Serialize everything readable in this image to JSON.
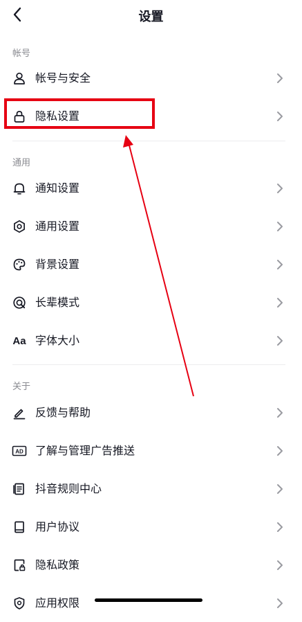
{
  "header": {
    "title": "设置"
  },
  "sections": {
    "account": {
      "label": "帐号"
    },
    "general": {
      "label": "通用"
    },
    "about": {
      "label": "关于"
    }
  },
  "items": {
    "account_security": "帐号与安全",
    "privacy_settings": "隐私设置",
    "notification_settings": "通知设置",
    "general_settings": "通用设置",
    "background_settings": "背景设置",
    "elder_mode": "长辈模式",
    "font_size": "字体大小",
    "feedback_help": "反馈与帮助",
    "ad_management": "了解与管理广告推送",
    "rules_center": "抖音规则中心",
    "user_agreement": "用户协议",
    "privacy_policy": "隐私政策",
    "app_permissions": "应用权限"
  },
  "icons": {
    "font_size_glyph": "Aa",
    "ad_glyph": "AD"
  },
  "colors": {
    "highlight": "#e60012",
    "annotation_arrow": "#e60012",
    "text": "#161823",
    "section_label": "#8a8b91"
  }
}
